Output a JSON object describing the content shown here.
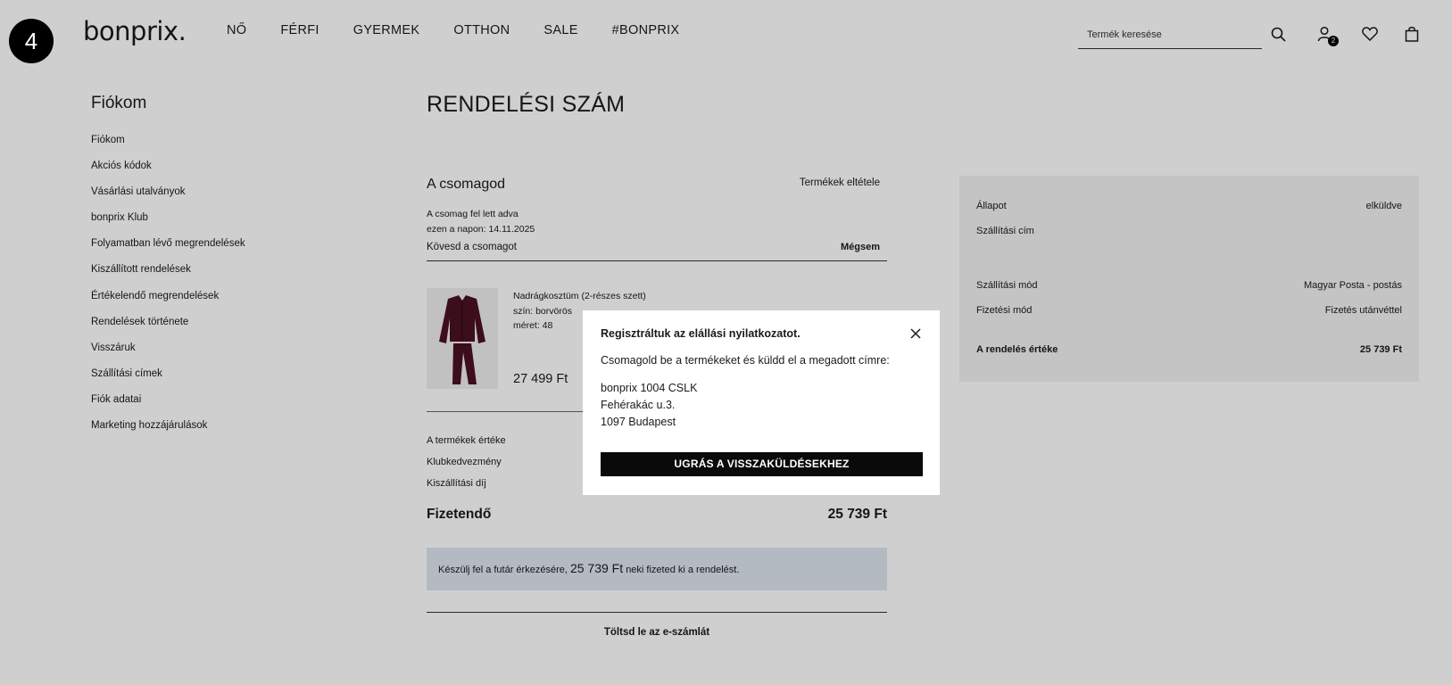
{
  "step_badge": "4",
  "header": {
    "logo": "bonprix.",
    "nav": [
      "NŐ",
      "FÉRFI",
      "GYERMEK",
      "OTTHON",
      "SALE",
      "#BONPRIX"
    ],
    "search_placeholder": "Termék keresése",
    "cart_count": "2",
    "icons": [
      "search-icon",
      "account-icon",
      "heart-icon",
      "bag-icon"
    ]
  },
  "sidebar": {
    "title": "Fiókom",
    "items": [
      "Fiókom",
      "Akciós kódok",
      "Vásárlási utalványok",
      "bonprix Klub",
      "Folyamatban lévő megrendelések",
      "Kiszállított rendelések",
      "Értékelendő megrendelések",
      "Rendelések története",
      "Visszáruk",
      "Szállítási címek",
      "Fiók adatai",
      "Marketing hozzájárulások"
    ]
  },
  "main": {
    "title": "RENDELÉSI SZÁM",
    "package": {
      "title": "A csomagod",
      "cancel_products": "Termékek eltétele",
      "sent_line1": "A csomag fel lett adva",
      "sent_line2": "ezen a napon: 14.11.2025",
      "track": "Kövesd a csomagot",
      "cancel": "Mégsem"
    },
    "product": {
      "name": "Nadrágkosztüm (2-részes szett)",
      "color": "szín: borvörös",
      "size": "méret: 48",
      "price": "27 499 Ft"
    },
    "summary": {
      "products_value": "A termékek értéke",
      "club_discount": "Klubkedvezmény",
      "shipping_fee": "Kiszállítási díj",
      "payable_label": "Fizetendő",
      "payable_value": "25 739 Ft"
    },
    "notice": {
      "prefix": "Készülj fel a futár érkezésére,",
      "amount": "25 739 Ft",
      "suffix": "neki fizeted ki a rendelést."
    },
    "invoice": "Töltsd le az e-számlát"
  },
  "status": {
    "state_label": "Állapot",
    "state_value": "elküldve",
    "address_label": "Szállítási cím",
    "shipping_method_label": "Szállítási mód",
    "shipping_method_value": "Magyar Posta - postás",
    "payment_method_label": "Fizetési mód",
    "payment_method_value": "Fizetés utánvéttel",
    "order_value_label": "A rendelés értéke",
    "order_value_value": "25 739 Ft"
  },
  "modal": {
    "title": "Regisztráltuk az elállási nyilatkozatot.",
    "description": "Csomagold be a termékeket és küldd el a megadott címre:",
    "address": [
      "bonprix 1004 CSLK",
      "Fehérakác u.3.",
      "1097 Budapest"
    ],
    "button": "UGRÁS A VISSZAKÜLDÉSEKHEZ"
  },
  "colors": {
    "overlay": "#000000",
    "notice_bg": "#dde6ef",
    "status_bg": "#f2f2f2",
    "button_bg": "#0a0a0a",
    "product_color": "#4a1020"
  }
}
